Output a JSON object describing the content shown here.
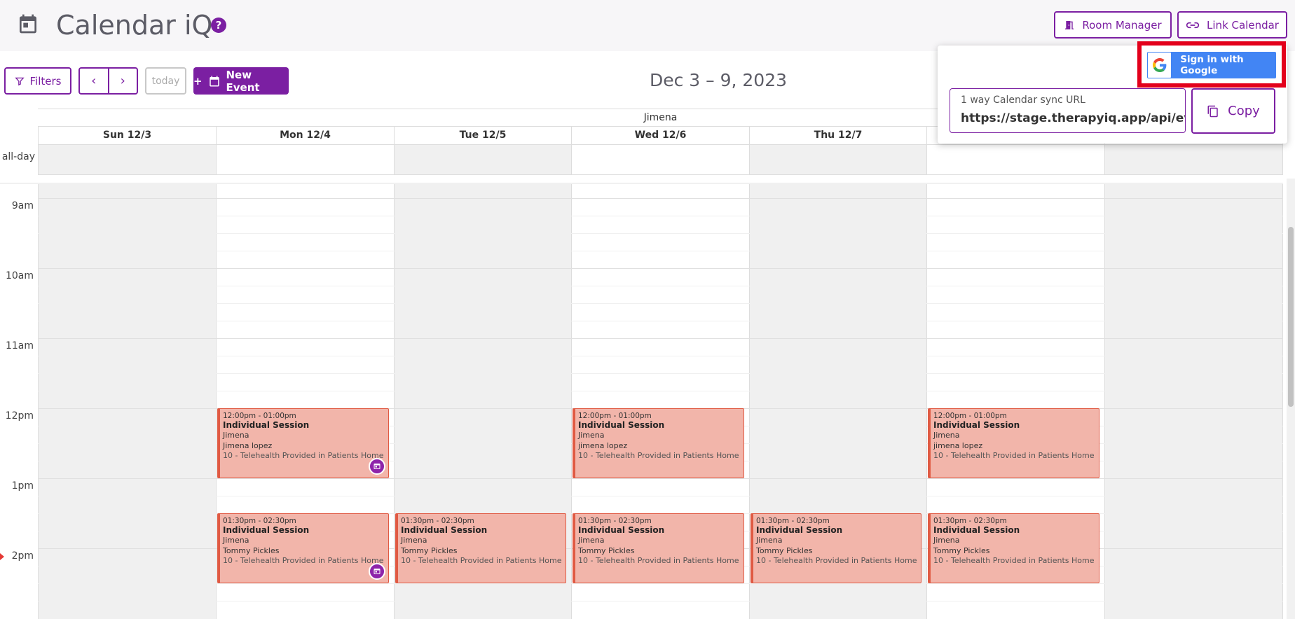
{
  "header": {
    "title": "Calendar iQ",
    "help_glyph": "?",
    "room_manager_label": "Room Manager",
    "link_calendar_label": "Link Calendar"
  },
  "toolbar": {
    "filters_label": "Filters",
    "prev_glyph": "‹",
    "next_glyph": "›",
    "today_label": "today",
    "new_event_label": "New Event",
    "new_event_plus": "+",
    "range_title": "Dec 3 – 9, 2023"
  },
  "calendar": {
    "resource": "Jimena",
    "allday_label": "all-day",
    "days": [
      "Sun 12/3",
      "Mon 12/4",
      "Tue 12/5",
      "Wed 12/6",
      "Thu 12/7",
      "",
      ""
    ],
    "times": [
      "9am",
      "10am",
      "11am",
      "12pm",
      "1pm",
      "2pm"
    ],
    "events": [
      {
        "time": "12:00pm - 01:00pm",
        "title": "Individual Session",
        "provider": "Jimena",
        "client": "Jimena lopez",
        "location": "10 - Telehealth Provided in Patients Home"
      },
      {
        "time": "12:00pm - 01:00pm",
        "title": "Individual Session",
        "provider": "Jimena",
        "client": "jimena lopez",
        "location": "10 - Telehealth Provided in Patients Home"
      },
      {
        "time": "12:00pm - 01:00pm",
        "title": "Individual Session",
        "provider": "Jimena",
        "client": "jimena lopez",
        "location": "10 - Telehealth Provided in Patients Home"
      },
      {
        "time": "01:30pm - 02:30pm",
        "title": "Individual Session",
        "provider": "Jimena",
        "client": "Tommy Pickles",
        "location": "10 - Telehealth Provided in Patients Home"
      },
      {
        "time": "01:30pm - 02:30pm",
        "title": "Individual Session",
        "provider": "Jimena",
        "client": "Tommy Pickles",
        "location": "10 - Telehealth Provided in Patients Home"
      },
      {
        "time": "01:30pm - 02:30pm",
        "title": "Individual Session",
        "provider": "Jimena",
        "client": "Tommy Pickles",
        "location": "10 - Telehealth Provided in Patients Home"
      },
      {
        "time": "01:30pm - 02:30pm",
        "title": "Individual Session",
        "provider": "Jimena",
        "client": "Tommy Pickles",
        "location": "10 - Telehealth Provided in Patients Home"
      },
      {
        "time": "01:30pm - 02:30pm",
        "title": "Individual Session",
        "provider": "Jimena",
        "client": "Tommy Pickles",
        "location": "10 - Telehealth Provided in Patients Home"
      }
    ]
  },
  "popover": {
    "google_label": "Sign in with Google",
    "sync_label": "1 way Calendar sync URL",
    "sync_value": "https://stage.therapyiq.app/api/events",
    "copy_label": "Copy"
  },
  "colors": {
    "brand": "#7b1fa2",
    "event_fill": "#f2b5aa",
    "event_border": "#e05a43",
    "google_blue": "#4285f4",
    "highlight": "#e3001b"
  }
}
